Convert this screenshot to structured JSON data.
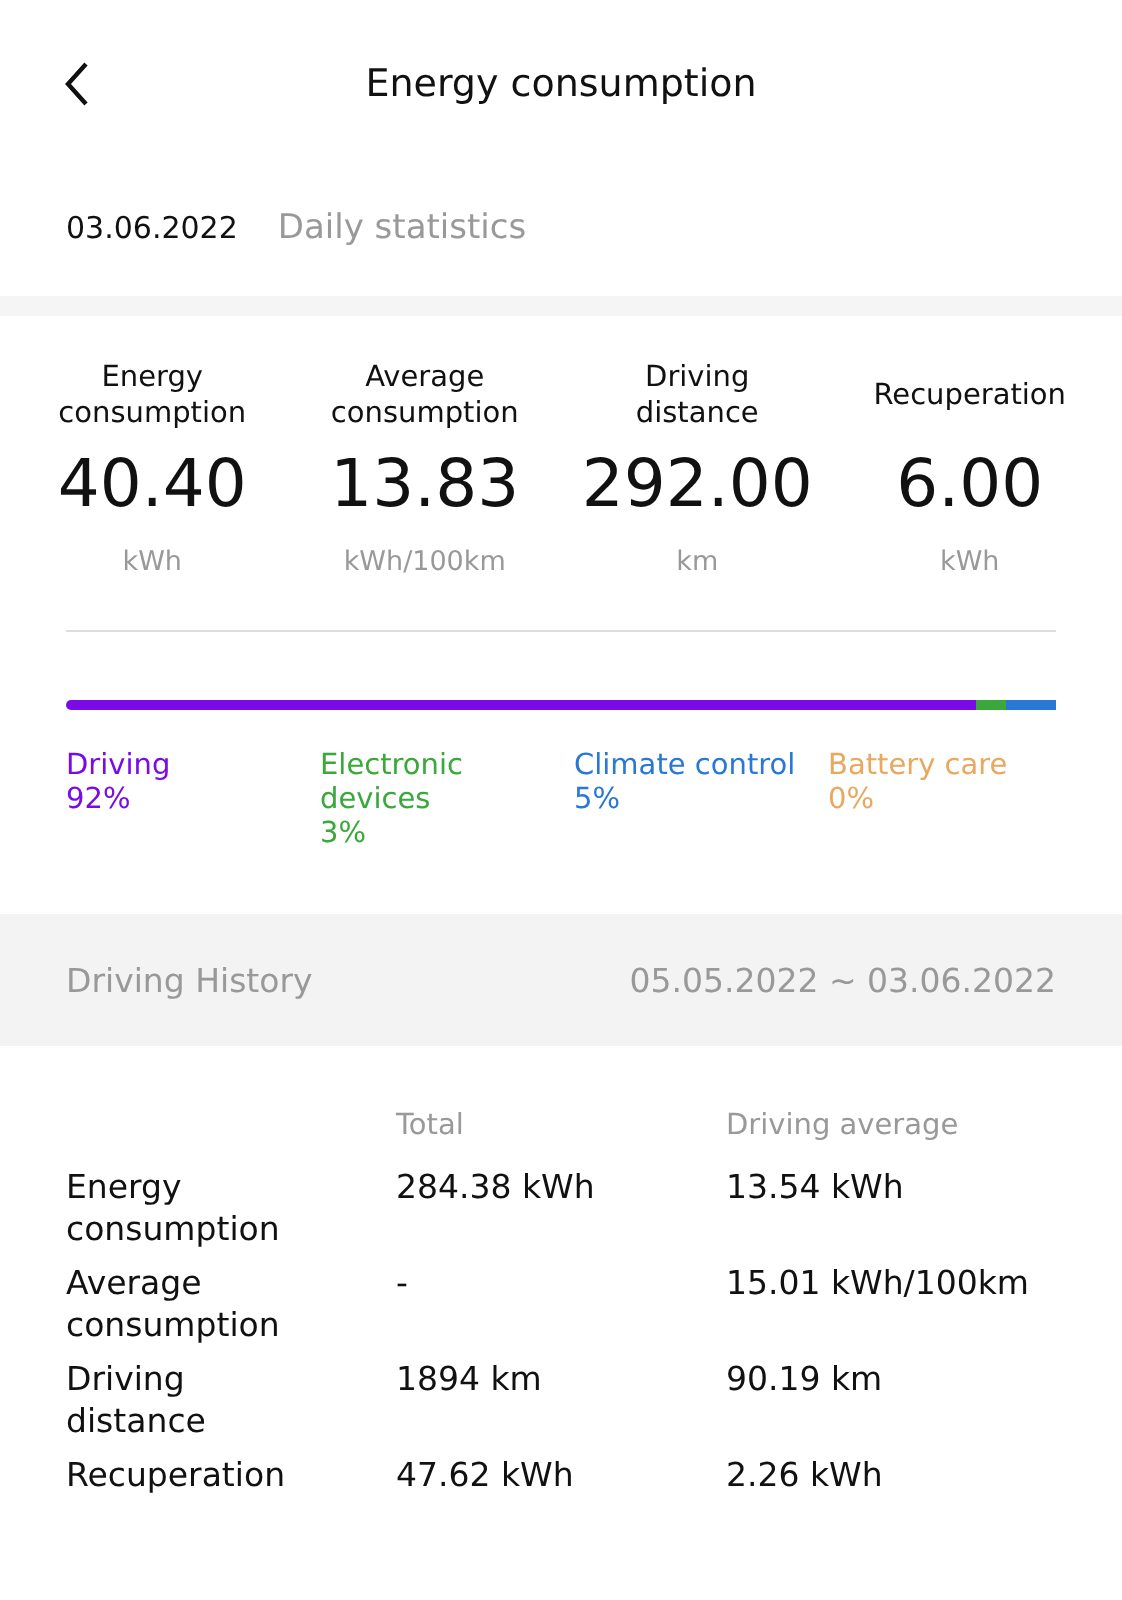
{
  "header": {
    "title": "Energy consumption"
  },
  "date_row": {
    "date": "03.06.2022",
    "label": "Daily statistics"
  },
  "stats": [
    {
      "label": "Energy consumption",
      "value": "40.40",
      "unit": "kWh"
    },
    {
      "label": "Average consumption",
      "value": "13.83",
      "unit": "kWh/100km"
    },
    {
      "label": "Driving distance",
      "value": "292.00",
      "unit": "km"
    },
    {
      "label": "Recuperation",
      "value": "6.00",
      "unit": "kWh"
    }
  ],
  "breakdown": [
    {
      "label": "Driving",
      "percent": "92%",
      "color": "#7a0be6"
    },
    {
      "label": "Electronic devices",
      "percent": "3%",
      "color": "#3aa83a"
    },
    {
      "label": "Climate control",
      "percent": "5%",
      "color": "#2a78d6"
    },
    {
      "label": "Battery care",
      "percent": "0%",
      "color": "#e8a860"
    }
  ],
  "history": {
    "title": "Driving History",
    "range": "05.05.2022 ~ 03.06.2022",
    "columns": [
      "Total",
      "Driving average"
    ],
    "rows": [
      {
        "label": "Energy consumption",
        "total": "284.38 kWh",
        "average": "13.54 kWh"
      },
      {
        "label": "Average consumption",
        "total": "-",
        "average": "15.01 kWh/100km"
      },
      {
        "label": "Driving distance",
        "total": "1894 km",
        "average": "90.19 km"
      },
      {
        "label": "Recuperation",
        "total": "47.62 kWh",
        "average": "2.26 kWh"
      }
    ]
  }
}
